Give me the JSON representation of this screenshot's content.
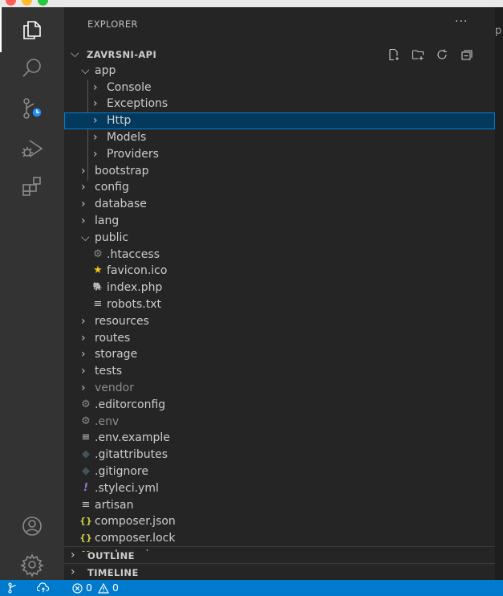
{
  "window": {
    "traffic_lights": [
      "#ff5f57",
      "#febc2e",
      "#28c840"
    ]
  },
  "activity_bar": {
    "items": [
      {
        "name": "explorer-icon",
        "active": true
      },
      {
        "name": "search-icon"
      },
      {
        "name": "source-control-icon",
        "badge": "clock"
      },
      {
        "name": "run-and-debug-icon"
      },
      {
        "name": "extensions-icon"
      }
    ],
    "bottom": [
      {
        "name": "accounts-icon"
      },
      {
        "name": "settings-gear-icon"
      }
    ]
  },
  "explorer": {
    "title": "EXPLORER",
    "more": "···",
    "root": "ZAVRSNI-API",
    "root_actions": [
      "new-file-icon",
      "new-folder-icon",
      "refresh-icon",
      "collapse-all-icon"
    ],
    "tree": [
      {
        "label": "app",
        "type": "folder",
        "open": true,
        "depth": 0
      },
      {
        "label": "Console",
        "type": "folder",
        "depth": 1
      },
      {
        "label": "Exceptions",
        "type": "folder",
        "depth": 1
      },
      {
        "label": "Http",
        "type": "folder",
        "depth": 1,
        "selected": true
      },
      {
        "label": "Models",
        "type": "folder",
        "depth": 1
      },
      {
        "label": "Providers",
        "type": "folder",
        "depth": 1
      },
      {
        "label": "bootstrap",
        "type": "folder",
        "depth": 0
      },
      {
        "label": "config",
        "type": "folder",
        "depth": 0
      },
      {
        "label": "database",
        "type": "folder",
        "depth": 0
      },
      {
        "label": "lang",
        "type": "folder",
        "depth": 0
      },
      {
        "label": "public",
        "type": "folder",
        "open": true,
        "depth": 0
      },
      {
        "label": ".htaccess",
        "type": "file",
        "icon": "gear",
        "depth": 1
      },
      {
        "label": "favicon.ico",
        "type": "file",
        "icon": "star",
        "depth": 1
      },
      {
        "label": "index.php",
        "type": "file",
        "icon": "php",
        "depth": 1
      },
      {
        "label": "robots.txt",
        "type": "file",
        "icon": "lines",
        "depth": 1
      },
      {
        "label": "resources",
        "type": "folder",
        "depth": 0
      },
      {
        "label": "routes",
        "type": "folder",
        "depth": 0
      },
      {
        "label": "storage",
        "type": "folder",
        "depth": 0
      },
      {
        "label": "tests",
        "type": "folder",
        "depth": 0
      },
      {
        "label": "vendor",
        "type": "folder",
        "depth": 0,
        "dim": true
      },
      {
        "label": ".editorconfig",
        "type": "file",
        "icon": "gear",
        "depth": 0
      },
      {
        "label": ".env",
        "type": "file",
        "icon": "gear",
        "depth": 0,
        "dim": true
      },
      {
        "label": ".env.example",
        "type": "file",
        "icon": "lines",
        "depth": 0
      },
      {
        "label": ".gitattributes",
        "type": "file",
        "icon": "git",
        "depth": 0
      },
      {
        "label": ".gitignore",
        "type": "file",
        "icon": "git",
        "depth": 0
      },
      {
        "label": ".styleci.yml",
        "type": "file",
        "icon": "yaml",
        "depth": 0
      },
      {
        "label": "artisan",
        "type": "file",
        "icon": "lines",
        "depth": 0
      },
      {
        "label": "composer.json",
        "type": "file",
        "icon": "json",
        "depth": 0
      },
      {
        "label": "composer.lock",
        "type": "file",
        "icon": "json",
        "depth": 0
      },
      {
        "label": "package.json",
        "type": "file",
        "icon": "json",
        "depth": 0
      }
    ],
    "sections": [
      "OUTLINE",
      "TIMELINE"
    ]
  },
  "editor_tab_glyph": "p",
  "status_bar": {
    "remote_icon": "source-control-icon",
    "sync_icon": "cloud-sync-icon",
    "errors": "0",
    "warnings": "0"
  },
  "colors": {
    "accent": "#007acc",
    "selection": "#04395e",
    "selection_border": "#007fd4",
    "star": "#f5c518",
    "php": "#8892bf",
    "yaml": "#a074c4",
    "json": "#cbcb41"
  }
}
